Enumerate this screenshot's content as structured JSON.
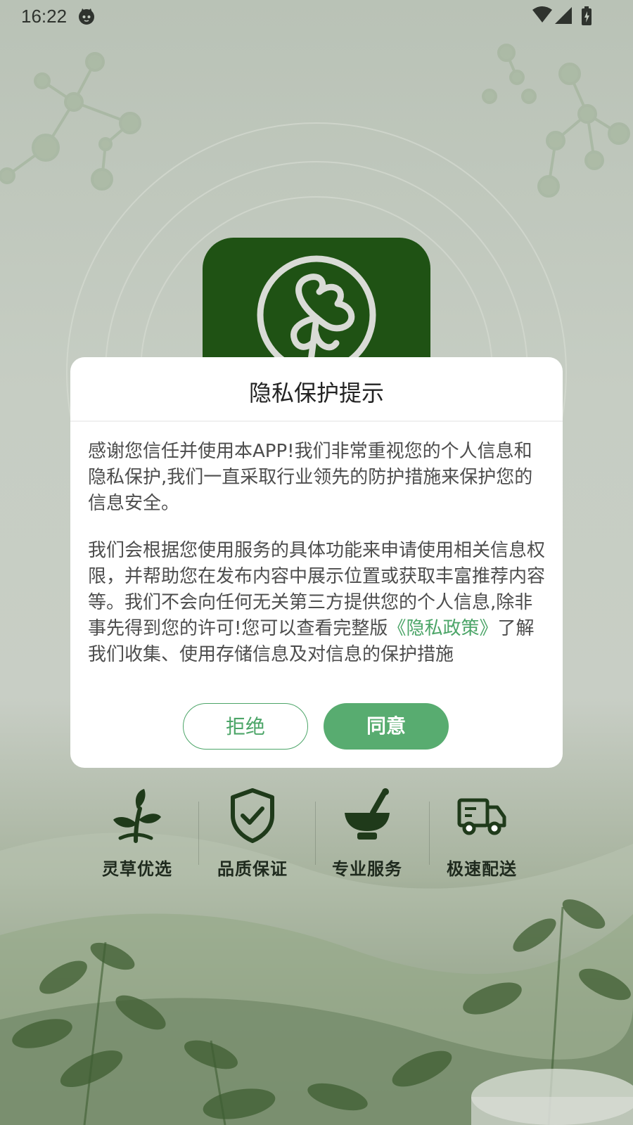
{
  "status_bar": {
    "time": "16:22",
    "app_icon": "cat-face-icon",
    "icons": [
      "wifi-icon",
      "signal-icon",
      "battery-charging-icon"
    ]
  },
  "app_logo": {
    "icon": "clover-leaf-icon",
    "color": "#1f5214"
  },
  "features": [
    {
      "icon": "herb-sprout-icon",
      "label": "灵草优选"
    },
    {
      "icon": "shield-check-icon",
      "label": "品质保证"
    },
    {
      "icon": "mortar-pestle-icon",
      "label": "专业服务"
    },
    {
      "icon": "delivery-truck-icon",
      "label": "极速配送"
    }
  ],
  "dialog": {
    "title": "隐私保护提示",
    "paragraph1": "感谢您信任并使用本APP!我们非常重视您的个人信息和隐私保护,我们一直采取行业领先的防护措施来保护您的信息安全。",
    "paragraph2_before": "我们会根据您使用服务的具体功能来申请使用相关信息权限，并帮助您在发布内容中展示位置或获取丰富推荐内容等。我们不会向任何无关第三方提供您的个人信息,除非事先得到您的许可!您可以查看完整版",
    "policy_link": "《隐私政策》",
    "paragraph2_after": "了解我们收集、使用存储信息及对信息的保护措施",
    "reject_label": "拒绝",
    "agree_label": "同意"
  },
  "colors": {
    "accent": "#58ac70",
    "link": "#4ca568",
    "logo_bg": "#1f5214"
  }
}
